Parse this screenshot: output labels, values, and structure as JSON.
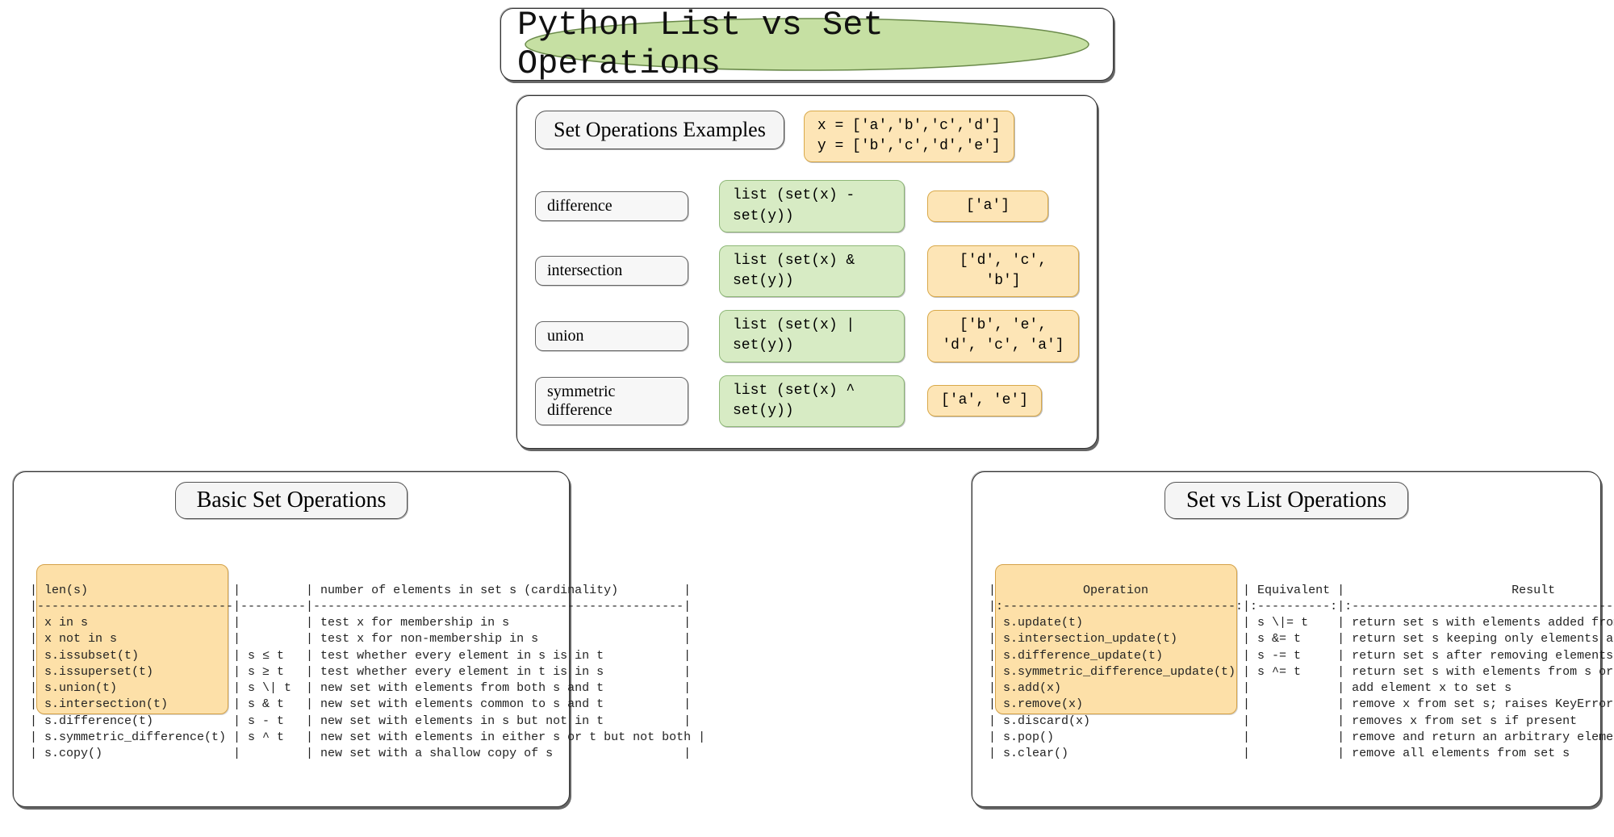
{
  "title": "Python List vs Set Operations",
  "examples": {
    "heading": "Set Operations Examples",
    "setup_x": "x = ['a','b','c','d']",
    "setup_y": "y = ['b','c','d','e']",
    "rows": [
      {
        "label": "difference",
        "expr": "list (set(x) - set(y))",
        "result": "['a']"
      },
      {
        "label": "intersection",
        "expr": "list (set(x) & set(y))",
        "result": "['d', 'c', 'b']"
      },
      {
        "label": "union",
        "expr": "list (set(x) | set(y))",
        "result": "['b', 'e', 'd', 'c', 'a']"
      },
      {
        "label": "symmetric difference",
        "expr": "list (set(x) ^ set(y))",
        "result": "['a', 'e']"
      }
    ]
  },
  "basic": {
    "heading": "Basic Set Operations",
    "table": "| len(s)                    |         | number of elements in set s (cardinality)         |\n|---------------------------|---------|---------------------------------------------------|\n| x in s                    |         | test x for membership in s                        |\n| x not in s                |         | test x for non-membership in s                    |\n| s.issubset(t)             | s ≤ t   | test whether every element in s is in t           |\n| s.issuperset(t)           | s ≥ t   | test whether every element in t is in s           |\n| s.union(t)                | s \\| t  | new set with elements from both s and t           |\n| s.intersection(t)         | s & t   | new set with elements common to s and t           |\n| s.difference(t)           | s - t   | new set with elements in s but not in t           |\n| s.symmetric_difference(t) | s ^ t   | new set with elements in either s or t but not both |\n| s.copy()                  |         | new set with a shallow copy of s                  |"
  },
  "vs": {
    "heading": "Set vs List Operations",
    "table": "|            Operation             | Equivalent |                       Result                        |\n|:--------------------------------:|:----------:|:---------------------------------------------------:|\n| s.update(t)                      | s \\|= t    | return set s with elements added from t             |\n| s.intersection_update(t)         | s &= t     | return set s keeping only elements also found in t  |\n| s.difference_update(t)           | s -= t     | return set s after removing elements found in t     |\n| s.symmetric_difference_update(t) | s ^= t     | return set s with elements from s or t but not both |\n| s.add(x)                         |            | add element x to set s                              |\n| s.remove(x)                      |            | remove x from set s; raises KeyError if not present |\n| s.discard(x)                     |            | removes x from set s if present                     |\n| s.pop()                          |            | remove and return an arbitrary element from s;      |\n| s.clear()                        |            | remove all elements from set s                      |"
  }
}
